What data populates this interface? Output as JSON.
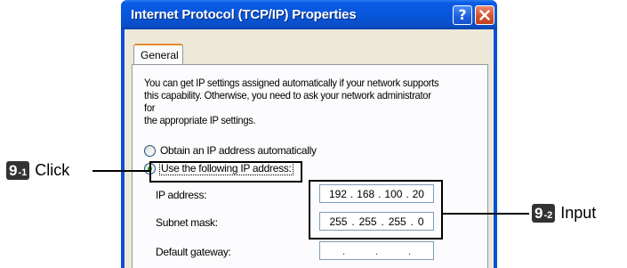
{
  "window": {
    "title": "Internet Protocol (TCP/IP) Properties",
    "help_button": "?"
  },
  "tabs": [
    {
      "label": "General",
      "active": true
    }
  ],
  "description": "You can get IP settings assigned automatically if your network supports\nthis capability. Otherwise, you need to ask your network administrator for\nthe appropriate IP settings.",
  "radios": [
    {
      "label": "Obtain an IP address automatically",
      "selected": false
    },
    {
      "label": "Use the following IP address:",
      "selected": true
    }
  ],
  "fields": [
    {
      "label": "IP address:",
      "octets": [
        "192",
        "168",
        "100",
        "20"
      ]
    },
    {
      "label": "Subnet mask:",
      "octets": [
        "255",
        "255",
        "255",
        "0"
      ]
    },
    {
      "label": "Default gateway:",
      "octets": [
        ".",
        ".",
        "."
      ]
    }
  ],
  "callouts": [
    {
      "step": "9",
      "sub": "-1",
      "text": "Click"
    },
    {
      "step": "9",
      "sub": "-2",
      "text": "Input"
    }
  ],
  "colors": {
    "title_bar": "#0a4fd8",
    "client": "#ece9d8",
    "badge": "#333333"
  }
}
